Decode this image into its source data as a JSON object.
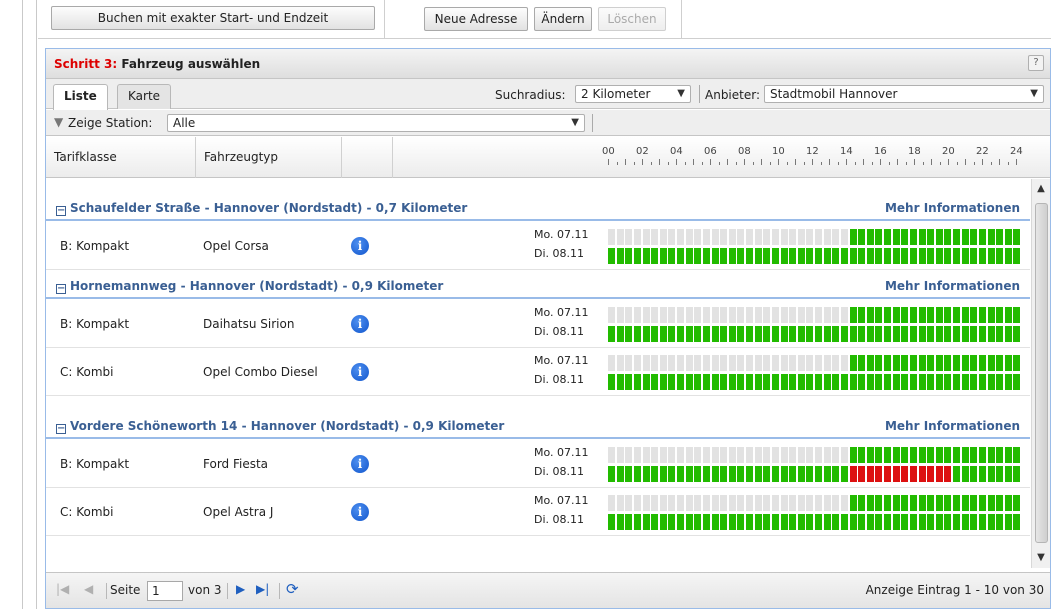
{
  "top": {
    "book_exact_label": "Buchen mit exakter Start- und Endzeit",
    "new_address_label": "Neue Adresse",
    "change_label": "Ändern",
    "delete_label": "Löschen"
  },
  "panel": {
    "step_label": "Schritt 3:",
    "title": "Fahrzeug auswählen",
    "help_label": "?"
  },
  "tabs": {
    "list": "Liste",
    "map": "Karte"
  },
  "search": {
    "radius_label": "Suchradius:",
    "radius_value": "2 Kilometer",
    "provider_label": "Anbieter:",
    "provider_value": "Stadtmobil Hannover"
  },
  "filter": {
    "label": "Zeige Station:",
    "value": "Alle"
  },
  "columns": {
    "tariff": "Tarifklasse",
    "vehicle_type": "Fahrzeugtyp"
  },
  "ruler_hours": [
    "00",
    "02",
    "04",
    "06",
    "08",
    "10",
    "12",
    "14",
    "16",
    "18",
    "20",
    "22",
    "24"
  ],
  "more_info_label": "Mehr Informationen",
  "groups": [
    {
      "title": "Schaufelder Straße - Hannover (Nordstadt) - 0,7 Kilometer"
    },
    {
      "title": "Hornemannweg - Hannover (Nordstadt) - 0,9 Kilometer"
    },
    {
      "title": "Vordere Schöneworth 14 - Hannover (Nordstadt) - 0,9 Kilometer"
    }
  ],
  "rows": [
    {
      "tariff": "B: Kompakt",
      "vehicle": "Opel Corsa",
      "day1": "Mo. 07.11",
      "day2": "Di. 08.11",
      "info_icon": "i"
    },
    {
      "tariff": "B: Kompakt",
      "vehicle": "Daihatsu Sirion",
      "day1": "Mo. 07.11",
      "day2": "Di. 08.11",
      "info_icon": "i"
    },
    {
      "tariff": "C: Kombi",
      "vehicle": "Opel Combo Diesel",
      "day1": "Mo. 07.11",
      "day2": "Di. 08.11",
      "info_icon": "i"
    },
    {
      "tariff": "B: Kompakt",
      "vehicle": "Ford Fiesta",
      "day1": "Mo. 07.11",
      "day2": "Di. 08.11",
      "info_icon": "i"
    },
    {
      "tariff": "C: Kombi",
      "vehicle": "Opel Astra J",
      "day1": "Mo. 07.11",
      "day2": "Di. 08.11",
      "info_icon": "i"
    }
  ],
  "availability": {
    "colors": {
      "free": "#22bb00",
      "booked": "#dd1111",
      "past": "#e2e2e2"
    },
    "slot_hours": 0.5,
    "day1_past_until_hour": 14,
    "red_booking_row": 3,
    "red_booking_day2_hours": [
      14,
      20
    ]
  },
  "pager": {
    "page_label": "Seite",
    "page_value": "1",
    "of_label": "von 3",
    "display_text": "Anzeige Eintrag 1 - 10 von 30"
  }
}
